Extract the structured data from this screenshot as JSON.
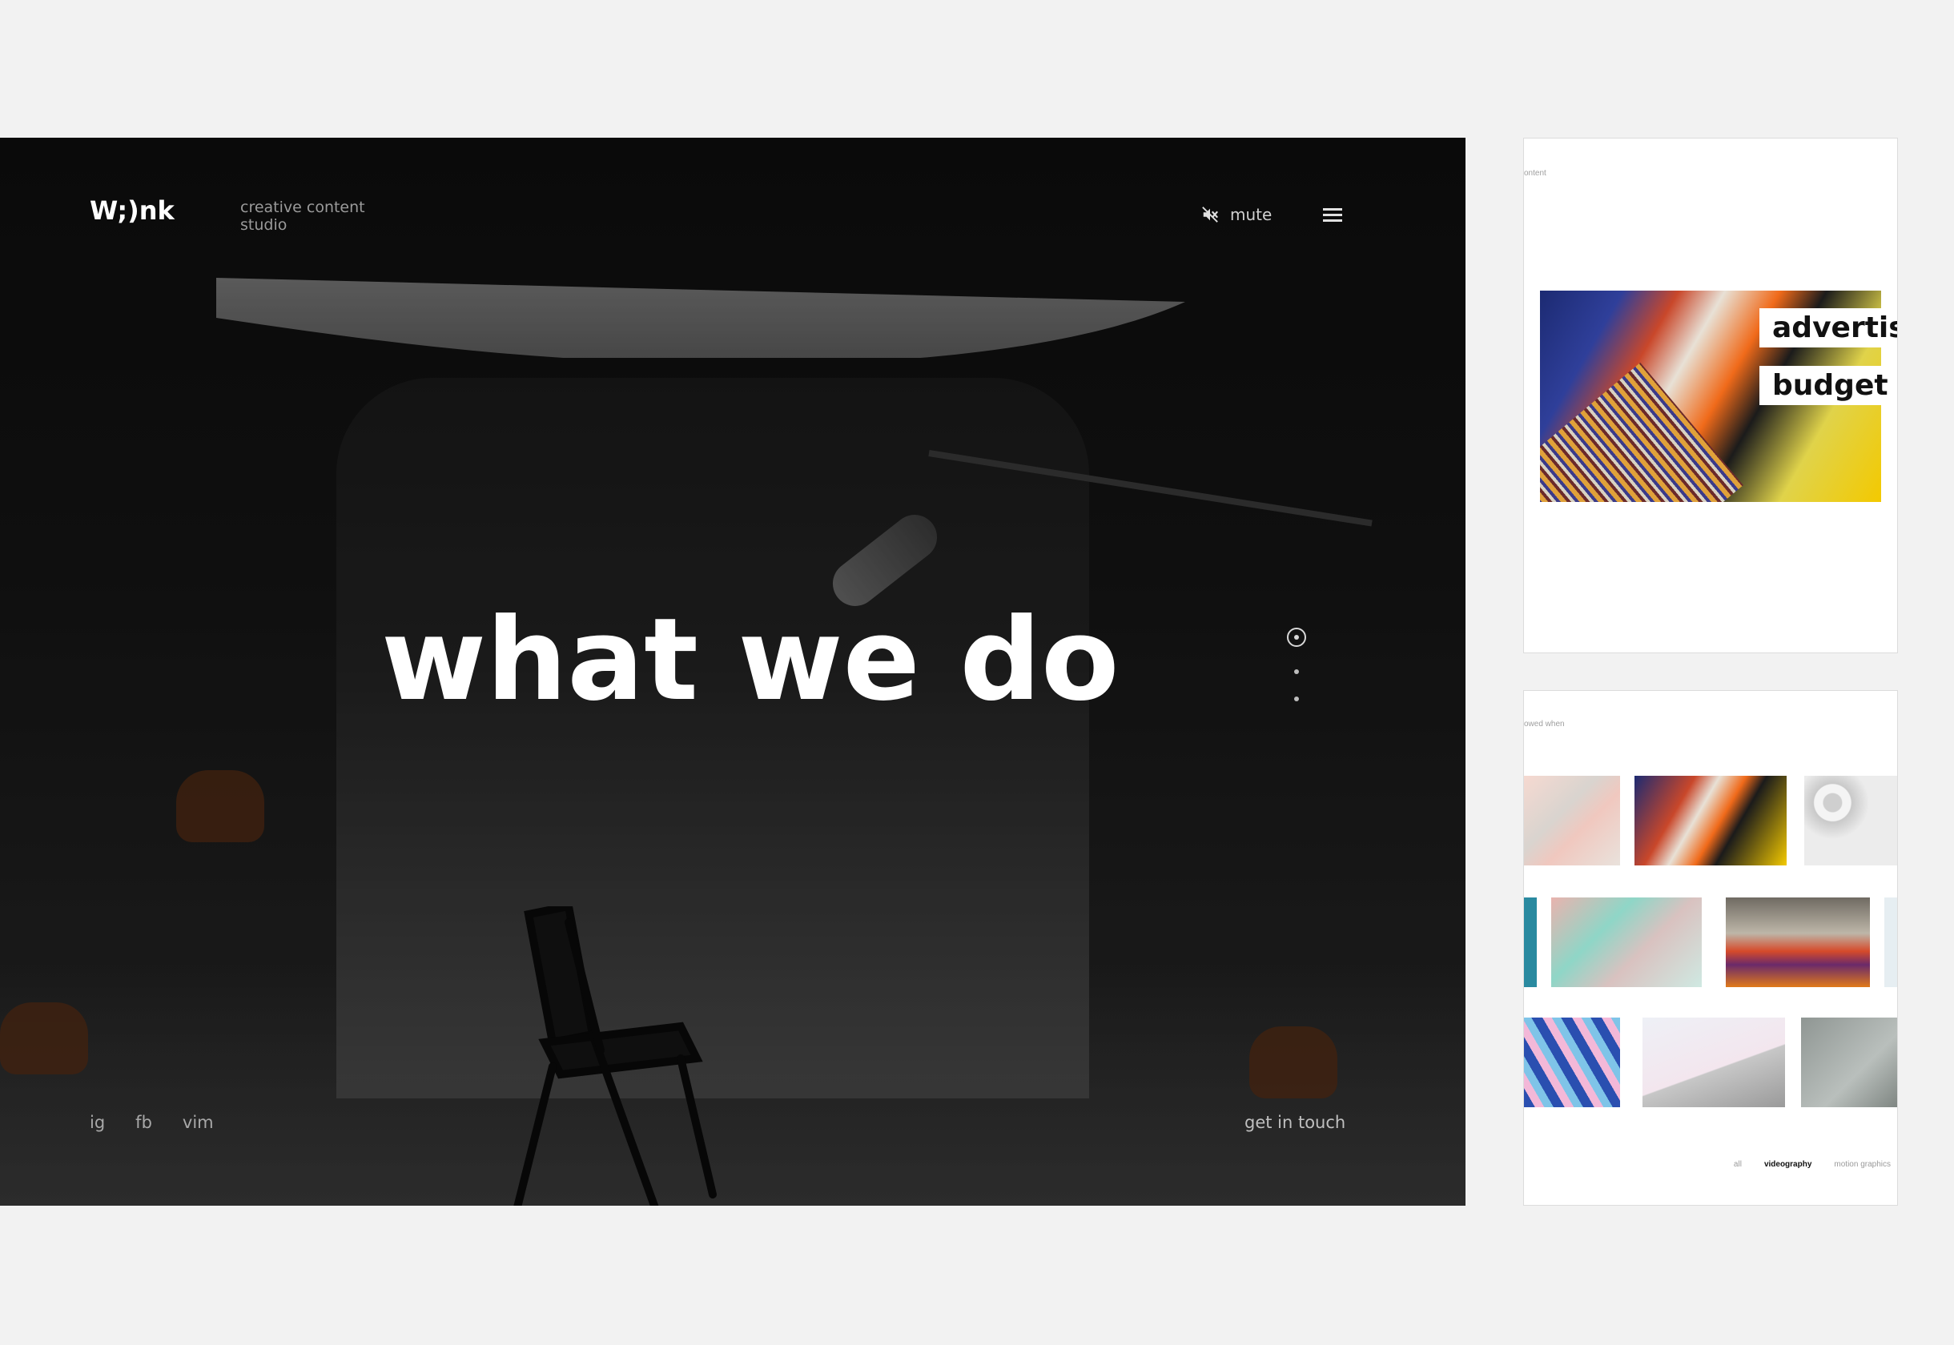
{
  "brand": {
    "logo": "W;)nk",
    "tagline_line1": "creative content",
    "tagline_line2": "studio"
  },
  "header": {
    "mute_label": "mute",
    "mute_icon": "speaker-muted-icon",
    "menu_icon": "hamburger-menu-icon"
  },
  "hero": {
    "headline": "what we do",
    "slides_total": 3,
    "slide_active": 1
  },
  "footer": {
    "social": [
      {
        "label": "ig"
      },
      {
        "label": "fb"
      },
      {
        "label": "vim"
      }
    ],
    "cta": "get in touch"
  },
  "preview_top": {
    "tiny_text": "ontent",
    "label_line1": "advertis",
    "label_line2": "budget"
  },
  "preview_bottom": {
    "tiny_text": "owed when",
    "filters": [
      {
        "label": "all",
        "active": false
      },
      {
        "label": "videography",
        "active": true
      },
      {
        "label": "motion graphics",
        "active": false
      }
    ]
  },
  "colors": {
    "page_bg": "#f2f2f2",
    "hero_text": "#ffffff",
    "muted_text": "#9a9a9a",
    "card_bg": "#ffffff"
  }
}
